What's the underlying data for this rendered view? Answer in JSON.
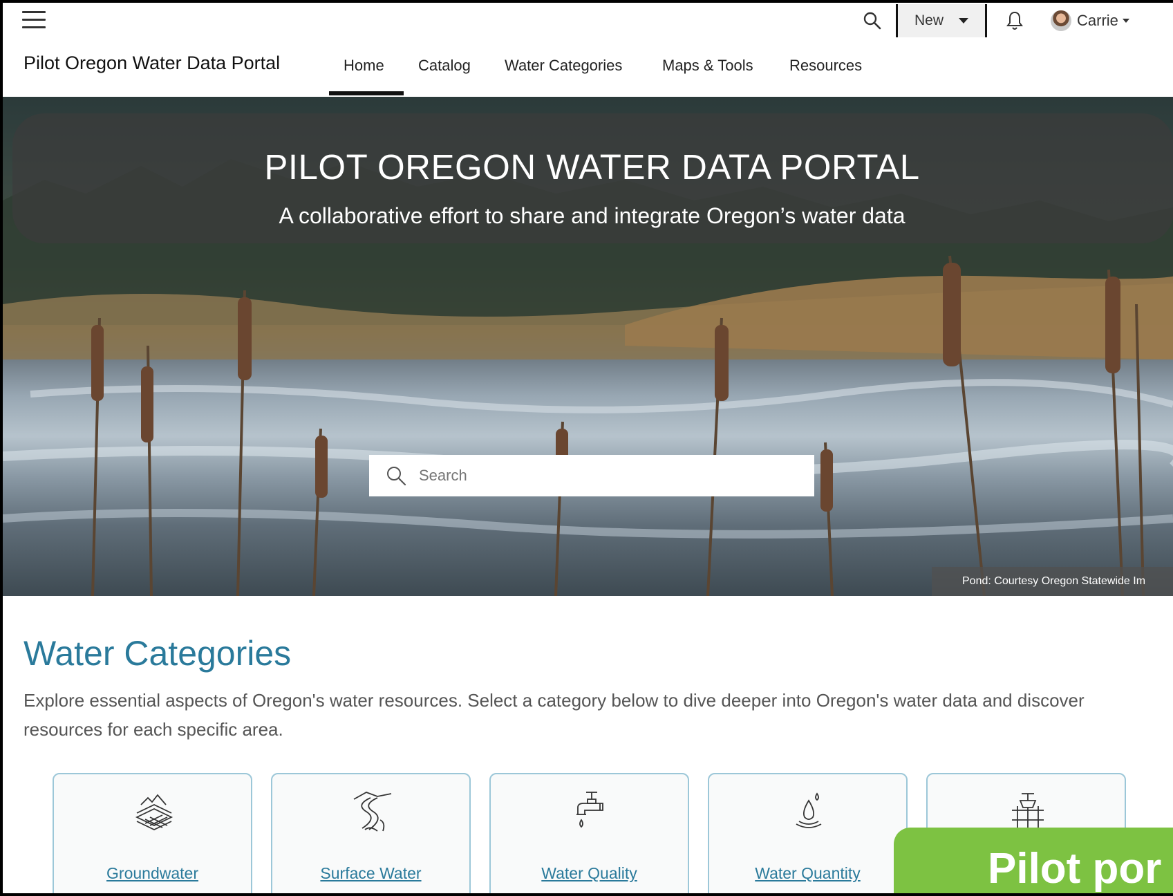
{
  "topbar": {
    "new_label": "New",
    "user_name": "Carrie",
    "icons": [
      "hamburger-menu-icon",
      "search-icon",
      "bell-icon",
      "avatar"
    ]
  },
  "nav": {
    "site_title": "Pilot Oregon Water Data Portal",
    "links": [
      "Home",
      "Catalog",
      "Water Categories",
      "Maps & Tools",
      "Resources"
    ],
    "active": "Home"
  },
  "hero": {
    "title": "PILOT OREGON WATER DATA PORTAL",
    "subtitle": "A collaborative effort to share and integrate Oregon’s water data",
    "search_placeholder": "Search",
    "credit": "Pond: Courtesy Oregon Statewide Im"
  },
  "categories": {
    "title": "Water Categories",
    "description": "Explore essential aspects of Oregon's water resources.  Select a category below to dive deeper into Oregon's water data and discover resources for each specific area.",
    "cards": [
      {
        "label": "Groundwater",
        "icon": "groundwater-layers-icon"
      },
      {
        "label": "Surface Water",
        "icon": "river-icon"
      },
      {
        "label": "Water Quality",
        "icon": "faucet-icon"
      },
      {
        "label": "Water Quantity",
        "icon": "water-drop-icon"
      },
      {
        "label": "",
        "icon": "water-infrastructure-icon"
      }
    ]
  },
  "callout": {
    "text": "Pilot por"
  },
  "colors": {
    "accent": "#2a7a9b",
    "card_border": "#9cc7d8",
    "callout": "#7dc242"
  }
}
